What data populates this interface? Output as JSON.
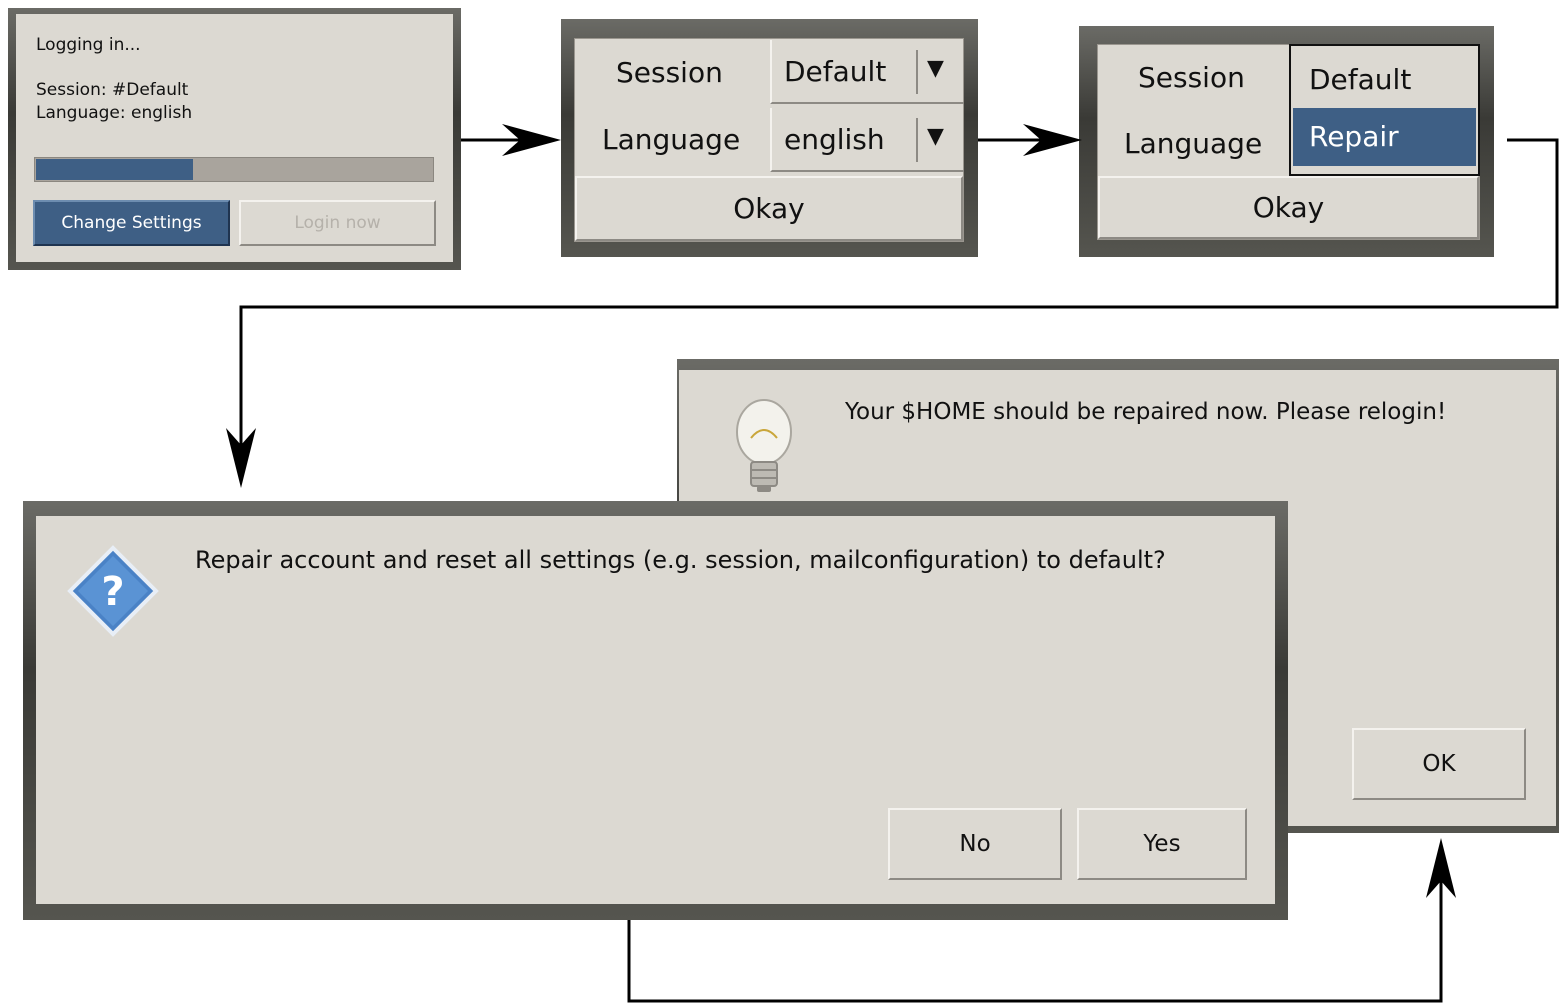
{
  "login_dialog": {
    "status": "Logging in...",
    "session_line": "Session: #Default",
    "language_line": "Language: english",
    "progress_fraction": 0.4,
    "change_settings_label": "Change Settings",
    "login_now_label": "Login now",
    "accent_color": "#3e5f85"
  },
  "settings_dialog": {
    "session_label": "Session",
    "session_value": "Default",
    "language_label": "Language",
    "language_value": "english",
    "okay_label": "Okay"
  },
  "settings_dropdown": {
    "session_label": "Session",
    "language_label": "Language",
    "options": [
      "Default",
      "Repair"
    ],
    "selected_option": "Repair",
    "okay_label": "Okay"
  },
  "confirm_dialog": {
    "icon": "question-icon",
    "message": "Repair account and reset all settings (e.g. session, mailconfiguration) to default?",
    "no_label": "No",
    "yes_label": "Yes"
  },
  "info_dialog": {
    "icon": "lightbulb-icon",
    "message": "Your $HOME should be repaired now. Please relogin!",
    "ok_label": "OK"
  }
}
